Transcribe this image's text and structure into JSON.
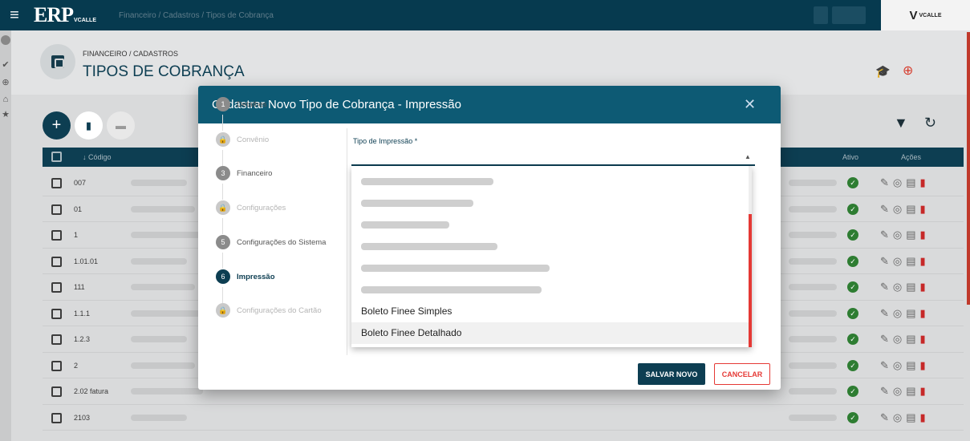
{
  "topbar": {
    "menu_icon": "menu-icon",
    "logo": "ERP",
    "logo_sub": "VCALLE",
    "breadcrumb": "Financeiro / Cadastros / Tipos de Cobrança",
    "brand": "V",
    "brand_sub": "VCALLE"
  },
  "header": {
    "section": "FINANCEIRO / CADASTROS",
    "title": "TIPOS DE COBRANÇA"
  },
  "table": {
    "columns": {
      "code": "↓ Código",
      "active": "Ativo",
      "actions": "Ações"
    },
    "rows": [
      {
        "code": "007"
      },
      {
        "code": "01"
      },
      {
        "code": "1"
      },
      {
        "code": "1.01.01"
      },
      {
        "code": "111"
      },
      {
        "code": "1.1.1"
      },
      {
        "code": "1.2.3"
      },
      {
        "code": "2"
      },
      {
        "code": "2.02 fatura"
      },
      {
        "code": "2103"
      }
    ]
  },
  "modal": {
    "title": "Cadastrar Novo Tipo de Cobrança - Impressão",
    "close": "✕",
    "steps": [
      {
        "num": "1",
        "label": "Detalhes",
        "state": "done"
      },
      {
        "num": "🔒",
        "label": "Convênio",
        "state": "disabled"
      },
      {
        "num": "3",
        "label": "Financeiro",
        "state": "done"
      },
      {
        "num": "🔒",
        "label": "Configurações",
        "state": "disabled"
      },
      {
        "num": "5",
        "label": "Configurações do Sistema",
        "state": "done"
      },
      {
        "num": "6",
        "label": "Impressão",
        "state": "active"
      },
      {
        "num": "🔒",
        "label": "Configurações do Cartão",
        "state": "disabled"
      }
    ],
    "field_label": "Tipo de Impressão *",
    "field_value": "",
    "options": [
      "Boleto Finee Simples",
      "Boleto Finee Detalhado"
    ],
    "save": "SALVAR NOVO",
    "cancel": "CANCELAR"
  }
}
